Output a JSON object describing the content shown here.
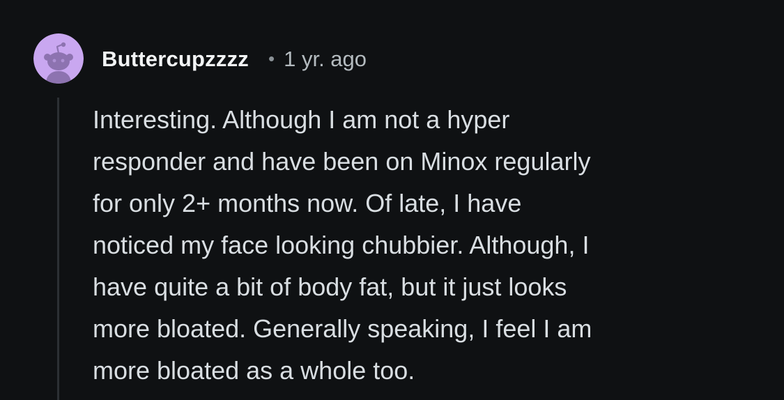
{
  "comment": {
    "author": "Buttercupzzzz",
    "separator": "•",
    "timestamp": "1 yr. ago",
    "avatar_icon": "snoo-avatar-icon",
    "body_lines": [
      "Interesting. Although I am not a hyper",
      "responder and have been on Minox regularly",
      "for only 2+ months now. Of late, I have",
      "noticed my face looking chubbier. Although, I",
      "have quite a bit of body fat, but it just looks",
      "more bloated. Generally speaking, I feel I am",
      "more bloated as a whole too."
    ]
  },
  "colors": {
    "background": "#0f1113",
    "avatar_background": "#c9a7f0",
    "avatar_figure": "#8d73b0",
    "username": "#f2f4f5",
    "timestamp": "#b4bbbf",
    "body_text": "#d9dee2",
    "thread_line": "#2c3034"
  }
}
